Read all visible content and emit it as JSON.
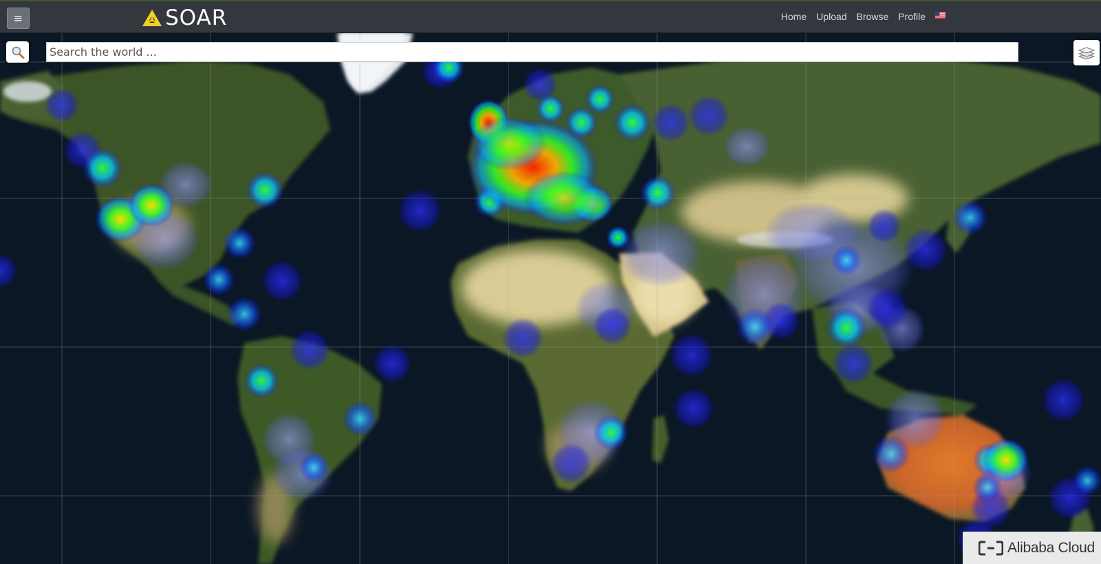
{
  "app": {
    "brand": "SOAR",
    "menu_glyph": "≡",
    "icons": {
      "menu": "hamburger-icon",
      "logo": "soar-triangle-logo",
      "search": "magnifier-icon",
      "layers": "layers-icon",
      "flag": "us-flag-icon",
      "sponsor": "alibaba-cloud-logo"
    },
    "colors": {
      "topbar": "#34373d",
      "logo_accent": "#f2d125",
      "ocean": "#0b1522",
      "land": "#3f5a2a",
      "desert": "#d8c58e"
    }
  },
  "nav": {
    "items": [
      {
        "label": "Home"
      },
      {
        "label": "Upload"
      },
      {
        "label": "Browse"
      },
      {
        "label": "Profile"
      }
    ]
  },
  "search": {
    "placeholder": "Search the world ...",
    "value": ""
  },
  "sponsor": {
    "label": "Alibaba Cloud"
  },
  "map": {
    "layer": "satellite",
    "overlay": "heatmap",
    "graticule": true,
    "heat_legend_colors": [
      "#1a1aff",
      "#00c8ff",
      "#00ff30",
      "#ffe000",
      "#ff2000"
    ]
  }
}
